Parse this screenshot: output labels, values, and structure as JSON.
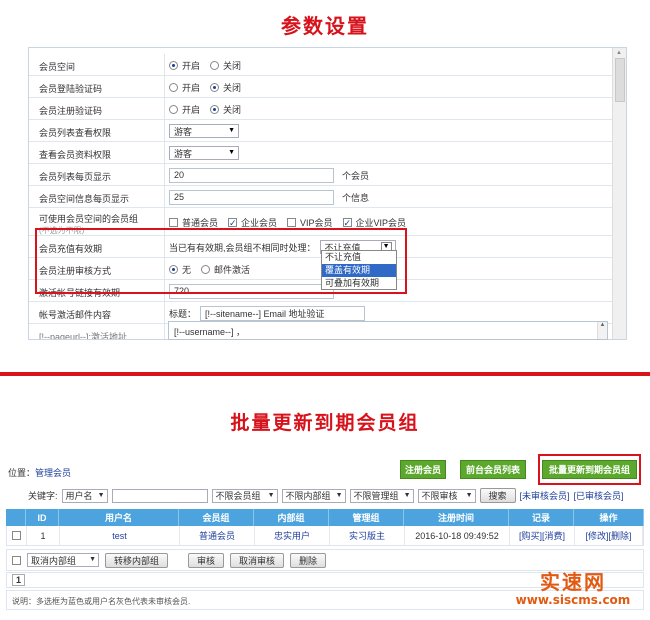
{
  "title_top": "参数设置",
  "title_bottom": "批量更新到期会员组",
  "settings": {
    "member_space": {
      "label": "会员空间",
      "opt_on": "开启",
      "opt_off": "关闭",
      "selected": "on"
    },
    "login_captcha": {
      "label": "会员登陆验证码",
      "opt_on": "开启",
      "opt_off": "关闭",
      "selected": "off"
    },
    "register_captcha": {
      "label": "会员注册验证码",
      "opt_on": "开启",
      "opt_off": "关闭",
      "selected": "off"
    },
    "list_permission": {
      "label": "会员列表查看权限",
      "value": "游客"
    },
    "profile_permission": {
      "label": "查看会员资料权限",
      "value": "游客"
    },
    "list_per_page": {
      "label": "会员列表每页显示",
      "value": "20",
      "unit": "个会员"
    },
    "space_per_page": {
      "label": "会员空间信息每页显示",
      "value": "25",
      "unit": "个信息"
    },
    "space_groups": {
      "label": "可使用会员空间的会员组",
      "sublabel": "(不选为不限)",
      "opt1": "普通会员",
      "opt2": "企业会员",
      "opt3": "VIP会员",
      "opt4": "企业VIP会员"
    },
    "recharge": {
      "label": "会员充值有效期",
      "prompt": "当已有有效期,会员组不相同时处理：",
      "value": "不让充值",
      "options": [
        "不让充值",
        "覆盖有效期",
        "可叠加有效期"
      ]
    },
    "register_audit": {
      "label": "会员注册审核方式",
      "opt_none": "无",
      "opt_mail": "邮件激活"
    },
    "activation_valid": {
      "label": "激活帐号链接有效期",
      "value": "720"
    },
    "activation_mail": {
      "label": "帐号激活邮件内容",
      "subject_label": "标题：",
      "subject_value": "[!--sitename--] Email 地址验证"
    },
    "pageurl": {
      "label": "[!--pageurl--]:激活地址"
    },
    "mail_body": {
      "value": "[!--username--] ，"
    }
  },
  "member_mgmt": {
    "position_label": "位置：",
    "position_link": "管理会员",
    "btn_register": "注册会员",
    "btn_frontend_list": "前台会员列表",
    "btn_batch_update": "批量更新到期会员组",
    "filter": {
      "keyword_label": "关键字:",
      "field": "用户名",
      "group": "不限会员组",
      "inner_group": "不限内部组",
      "admin_group": "不限管理组",
      "audit": "不限审核",
      "search": "搜索",
      "link_unaudited": "[未审核会员]",
      "link_audited": "[已审核会员]"
    },
    "columns": [
      "ID",
      "用户名",
      "会员组",
      "内部组",
      "管理组",
      "注册时间",
      "记录",
      "操作"
    ],
    "rows": [
      {
        "id": "1",
        "username": "test",
        "group": "普通会员",
        "inner": "忠实用户",
        "admin": "实习版主",
        "time": "2016-10-18 09:49:52",
        "rec1": "[购买]",
        "rec2": "[消费]",
        "op1": "[修改]",
        "op2": "[删除]"
      }
    ],
    "actions": {
      "cancel_inner": "取消内部组",
      "move_inner": "转移内部组",
      "audit": "审核",
      "cancel_audit": "取消审核",
      "delete": "删除"
    },
    "page": "1",
    "note": "说明：多选框为蓝色或用户名灰色代表未审核会员."
  },
  "watermark": {
    "name": "实速网",
    "url": "www.siscms.com"
  }
}
